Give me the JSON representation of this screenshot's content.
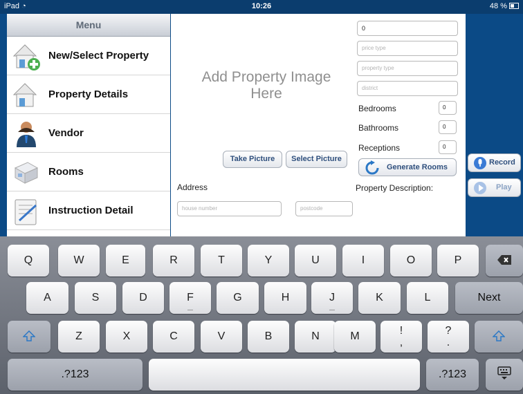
{
  "status_bar": {
    "device": "iPad",
    "time": "10:26",
    "battery": "48 %"
  },
  "sidebar": {
    "title": "Menu",
    "items": [
      {
        "label": "New/Select Property",
        "icon": "house-add-icon"
      },
      {
        "label": "Property Details",
        "icon": "house-icon"
      },
      {
        "label": "Vendor",
        "icon": "person-icon"
      },
      {
        "label": "Rooms",
        "icon": "room-icon"
      },
      {
        "label": "Instruction Detail",
        "icon": "document-icon"
      }
    ]
  },
  "property": {
    "image_placeholder": "Add Property Image Here",
    "take_picture": "Take Picture",
    "select_picture": "Select Picture",
    "price_value": "0",
    "price_type_placeholder": "price type",
    "property_type_placeholder": "property type",
    "district_placeholder": "district",
    "bedrooms_label": "Bedrooms",
    "bedrooms_value": "0",
    "bathrooms_label": "Bathrooms",
    "bathrooms_value": "0",
    "receptions_label": "Receptions",
    "receptions_value": "0",
    "generate_rooms": "Generate Rooms",
    "address_label": "Address",
    "house_number_placeholder": "house number",
    "postcode_placeholder": "postcode",
    "description_label": "Property Description:"
  },
  "audio": {
    "record": "Record",
    "play": "Play"
  },
  "keyboard": {
    "row1": [
      "Q",
      "W",
      "E",
      "R",
      "T",
      "Y",
      "U",
      "I",
      "O",
      "P"
    ],
    "row2": [
      "A",
      "S",
      "D",
      "F",
      "G",
      "H",
      "J",
      "K",
      "L"
    ],
    "row3": [
      "Z",
      "X",
      "C",
      "V",
      "B",
      "N",
      "M"
    ],
    "punct1": {
      "top": "!",
      "bottom": ","
    },
    "punct2": {
      "top": "?",
      "bottom": "."
    },
    "next": "Next",
    "numbers_left": ".?123",
    "numbers_right": ".?123"
  },
  "colors": {
    "background": "#0b4a86",
    "accent": "#2f4f7d",
    "record_icon": "#3a7bd5"
  }
}
